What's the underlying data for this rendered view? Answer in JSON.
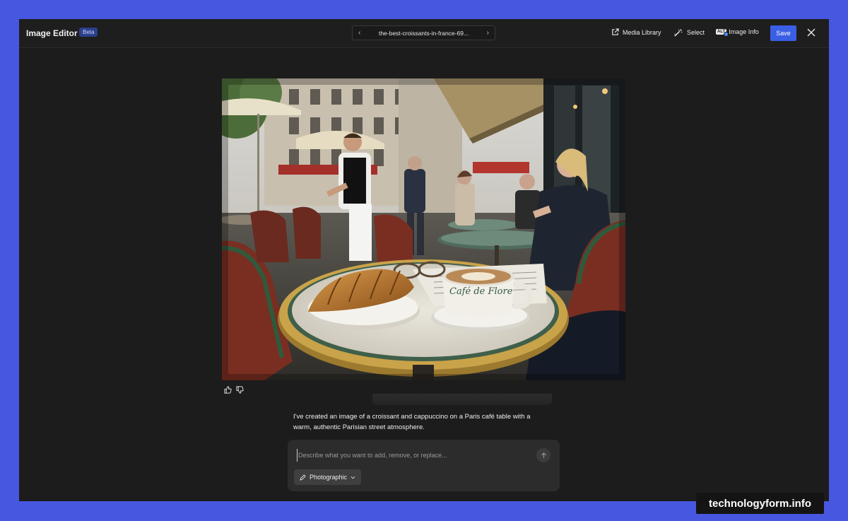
{
  "app": {
    "title": "Image Editor",
    "badge": "Beta"
  },
  "file_nav": {
    "filename": "the-best-croissants-in-france-69...",
    "prev_icon": "chevron-left-icon",
    "next_icon": "chevron-right-icon"
  },
  "toolbar": {
    "media_library_label": "Media Library",
    "select_label": "Select",
    "alt_badge": "ALT",
    "image_info_label": "Image Info",
    "save_label": "Save"
  },
  "photo": {
    "cup_text": "Café de Flore"
  },
  "feedback": {
    "like_icon": "thumbs-up-icon",
    "dislike_icon": "thumbs-down-icon"
  },
  "assistant": {
    "message": "I've created an image of a croissant and cappuccino on a Paris café table with a warm, authentic Parisian street atmosphere."
  },
  "prompt": {
    "value": "",
    "placeholder": "Describe what you want to add, remove, or replace...",
    "style_label": "Photographic"
  },
  "watermark": {
    "text": "technologyform.info"
  },
  "colors": {
    "frame_background": "#4757e0",
    "editor_background": "#1c1c1c",
    "save_button": "#3a5fe6",
    "beta_badge": "#2c3f8a"
  }
}
